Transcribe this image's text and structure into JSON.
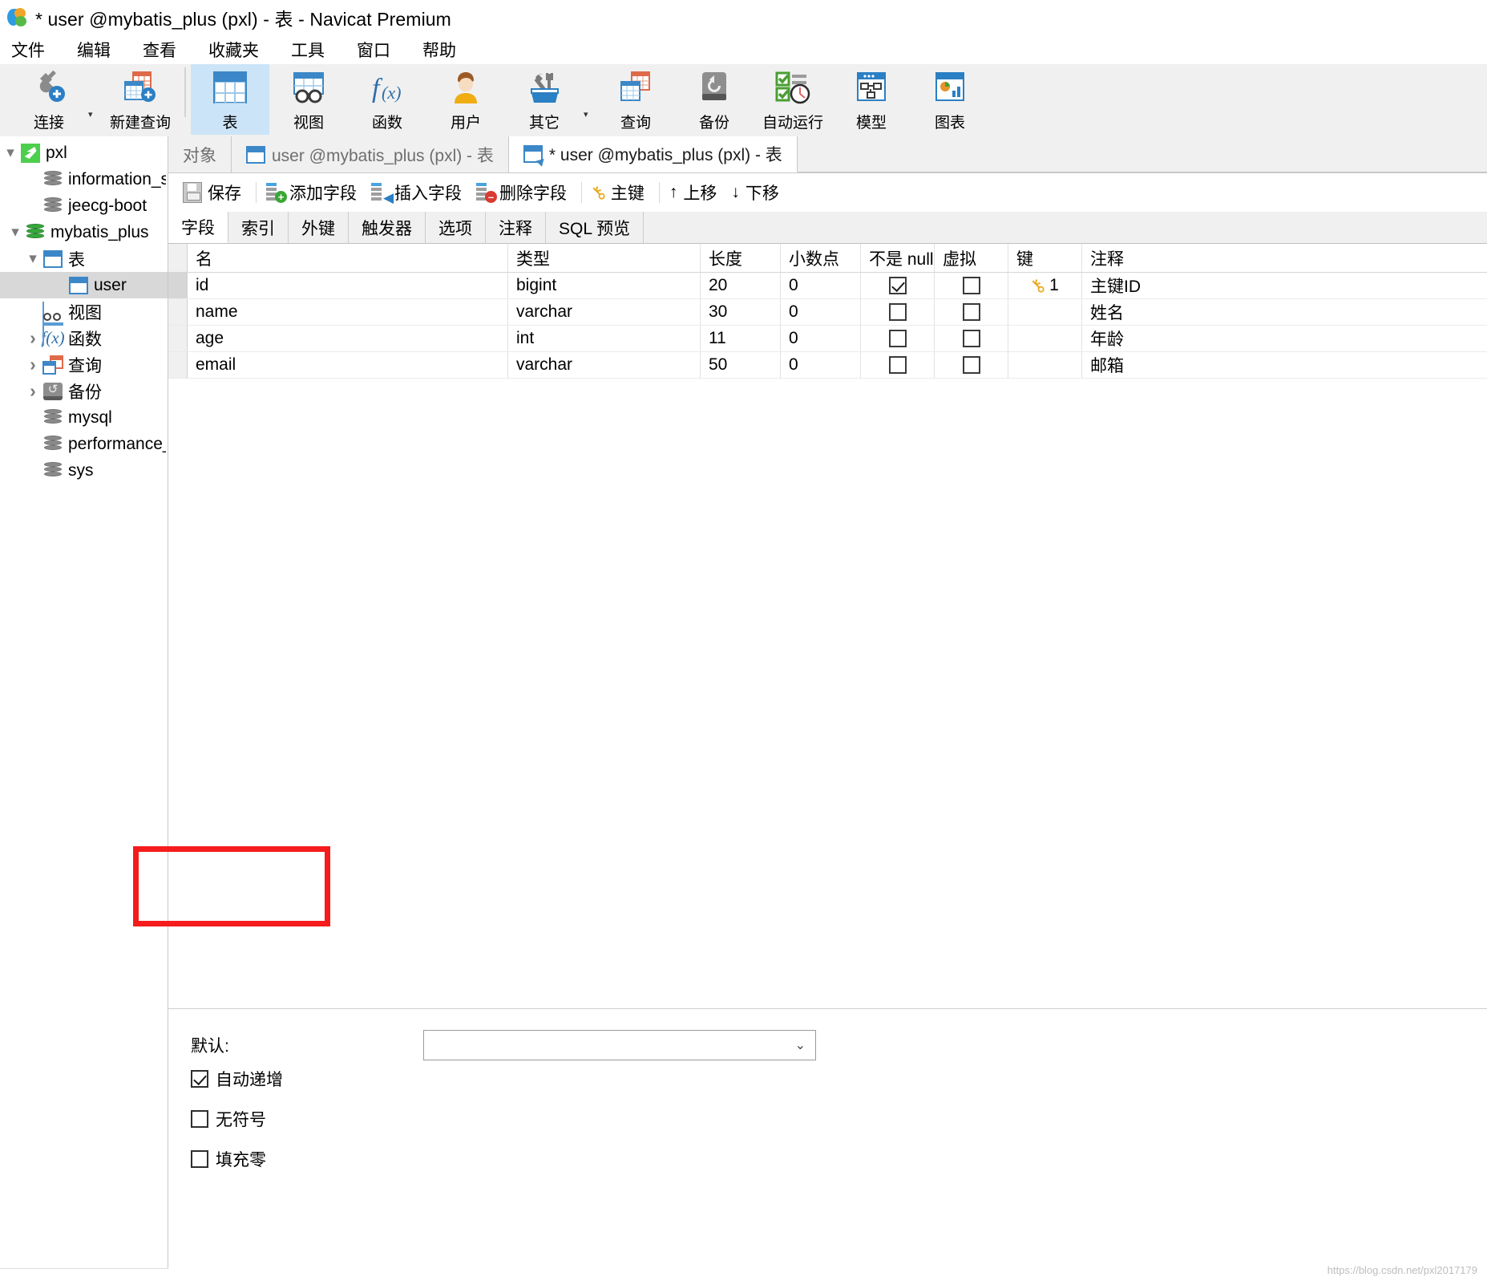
{
  "window": {
    "title": "* user @mybatis_plus (pxl) - 表 - Navicat Premium",
    "logo_icon": "navicat-logo-icon"
  },
  "menu": {
    "items": [
      {
        "label": "文件",
        "name": "menu-file"
      },
      {
        "label": "编辑",
        "name": "menu-edit"
      },
      {
        "label": "查看",
        "name": "menu-view"
      },
      {
        "label": "收藏夹",
        "name": "menu-favorites"
      },
      {
        "label": "工具",
        "name": "menu-tools"
      },
      {
        "label": "窗口",
        "name": "menu-window"
      },
      {
        "label": "帮助",
        "name": "menu-help"
      }
    ]
  },
  "toolbar": {
    "items": [
      {
        "label": "连接",
        "icon": "connection-icon",
        "selected": false,
        "caret": true
      },
      {
        "label": "新建查询",
        "icon": "new-query-icon",
        "selected": false,
        "caret": false
      },
      {
        "label": "表",
        "icon": "table-icon",
        "selected": true,
        "caret": false
      },
      {
        "label": "视图",
        "icon": "view-icon",
        "selected": false,
        "caret": false
      },
      {
        "label": "函数",
        "icon": "function-icon",
        "selected": false,
        "caret": false
      },
      {
        "label": "用户",
        "icon": "user-icon",
        "selected": false,
        "caret": false
      },
      {
        "label": "其它",
        "icon": "other-tools-icon",
        "selected": false,
        "caret": true
      },
      {
        "label": "查询",
        "icon": "query-icon",
        "selected": false,
        "caret": false
      },
      {
        "label": "备份",
        "icon": "backup-icon",
        "selected": false,
        "caret": false
      },
      {
        "label": "自动运行",
        "icon": "automation-icon",
        "selected": false,
        "caret": false
      },
      {
        "label": "模型",
        "icon": "model-icon",
        "selected": false,
        "caret": false
      },
      {
        "label": "图表",
        "icon": "chart-icon",
        "selected": false,
        "caret": false
      }
    ]
  },
  "sidebar": {
    "items": [
      {
        "label": "pxl",
        "depth": 0,
        "twisty": "open",
        "icon": "connection-leaf-icon",
        "selected": false
      },
      {
        "label": "information_s",
        "depth": 1,
        "twisty": "none",
        "icon": "database-icon",
        "selected": false
      },
      {
        "label": "jeecg-boot",
        "depth": 1,
        "twisty": "none",
        "icon": "database-icon",
        "selected": false
      },
      {
        "label": "mybatis_plus",
        "depth": 1,
        "twisty": "open",
        "icon": "database-active-icon",
        "selected": false
      },
      {
        "label": "表",
        "depth": 2,
        "twisty": "open",
        "icon": "tables-folder-icon",
        "selected": false
      },
      {
        "label": "user",
        "depth": 3,
        "twisty": "none",
        "icon": "table-icon",
        "selected": true
      },
      {
        "label": "视图",
        "depth": 2,
        "twisty": "none",
        "icon": "views-folder-icon",
        "selected": false
      },
      {
        "label": "函数",
        "depth": 2,
        "twisty": "closed",
        "icon": "functions-folder-icon",
        "selected": false
      },
      {
        "label": "查询",
        "depth": 2,
        "twisty": "closed",
        "icon": "queries-folder-icon",
        "selected": false
      },
      {
        "label": "备份",
        "depth": 2,
        "twisty": "closed",
        "icon": "backups-folder-icon",
        "selected": false
      },
      {
        "label": "mysql",
        "depth": 1,
        "twisty": "none",
        "icon": "database-icon",
        "selected": false
      },
      {
        "label": "performance_",
        "depth": 1,
        "twisty": "none",
        "icon": "database-icon",
        "selected": false
      },
      {
        "label": "sys",
        "depth": 1,
        "twisty": "none",
        "icon": "database-icon",
        "selected": false
      }
    ]
  },
  "tabs": [
    {
      "label": "对象",
      "icon": "none",
      "active": false,
      "name": "tab-objects"
    },
    {
      "label": "user @mybatis_plus (pxl) - 表",
      "icon": "table-icon",
      "active": false,
      "name": "tab-table-data"
    },
    {
      "label": "* user @mybatis_plus (pxl) - 表",
      "icon": "table-design-icon",
      "active": true,
      "name": "tab-table-design"
    }
  ],
  "actionbar": {
    "buttons": [
      {
        "label": "保存",
        "icon": "save-icon",
        "name": "save-button"
      },
      {
        "label": "添加字段",
        "icon": "add-field-icon",
        "name": "add-field-button"
      },
      {
        "label": "插入字段",
        "icon": "insert-field-icon",
        "name": "insert-field-button"
      },
      {
        "label": "删除字段",
        "icon": "delete-field-icon",
        "name": "delete-field-button"
      },
      {
        "label": "主键",
        "icon": "key-icon",
        "name": "primary-key-button"
      },
      {
        "label": "上移",
        "icon": "arrow-up-icon",
        "name": "move-up-button"
      },
      {
        "label": "下移",
        "icon": "arrow-down-icon",
        "name": "move-down-button"
      }
    ]
  },
  "subtabs": [
    {
      "label": "字段",
      "active": true,
      "name": "subtab-fields"
    },
    {
      "label": "索引",
      "active": false,
      "name": "subtab-indexes"
    },
    {
      "label": "外键",
      "active": false,
      "name": "subtab-foreign-keys"
    },
    {
      "label": "触发器",
      "active": false,
      "name": "subtab-triggers"
    },
    {
      "label": "选项",
      "active": false,
      "name": "subtab-options"
    },
    {
      "label": "注释",
      "active": false,
      "name": "subtab-comment"
    },
    {
      "label": "SQL 预览",
      "active": false,
      "name": "subtab-sql-preview"
    }
  ],
  "grid": {
    "columns": [
      "名",
      "类型",
      "长度",
      "小数点",
      "不是 null",
      "虚拟",
      "键",
      "注释"
    ],
    "rows": [
      {
        "name": "id",
        "type": "bigint",
        "length": "20",
        "decimals": "0",
        "not_null": true,
        "virtual": false,
        "key": "1",
        "comment": "主键ID",
        "selected": true
      },
      {
        "name": "name",
        "type": "varchar",
        "length": "30",
        "decimals": "0",
        "not_null": false,
        "virtual": false,
        "key": "",
        "comment": "姓名",
        "selected": false
      },
      {
        "name": "age",
        "type": "int",
        "length": "11",
        "decimals": "0",
        "not_null": false,
        "virtual": false,
        "key": "",
        "comment": "年龄",
        "selected": false
      },
      {
        "name": "email",
        "type": "varchar",
        "length": "50",
        "decimals": "0",
        "not_null": false,
        "virtual": false,
        "key": "",
        "comment": "邮箱",
        "selected": false
      }
    ]
  },
  "properties": {
    "default_label": "默认:",
    "default_value": "",
    "checkboxes": [
      {
        "label": "自动递增",
        "checked": true,
        "name": "auto-increment-checkbox"
      },
      {
        "label": "无符号",
        "checked": false,
        "name": "unsigned-checkbox"
      },
      {
        "label": "填充零",
        "checked": false,
        "name": "zerofill-checkbox"
      }
    ]
  },
  "annotation": {
    "highlight_color": "#f41c1c"
  },
  "watermark": "https://blog.csdn.net/pxl2017179"
}
